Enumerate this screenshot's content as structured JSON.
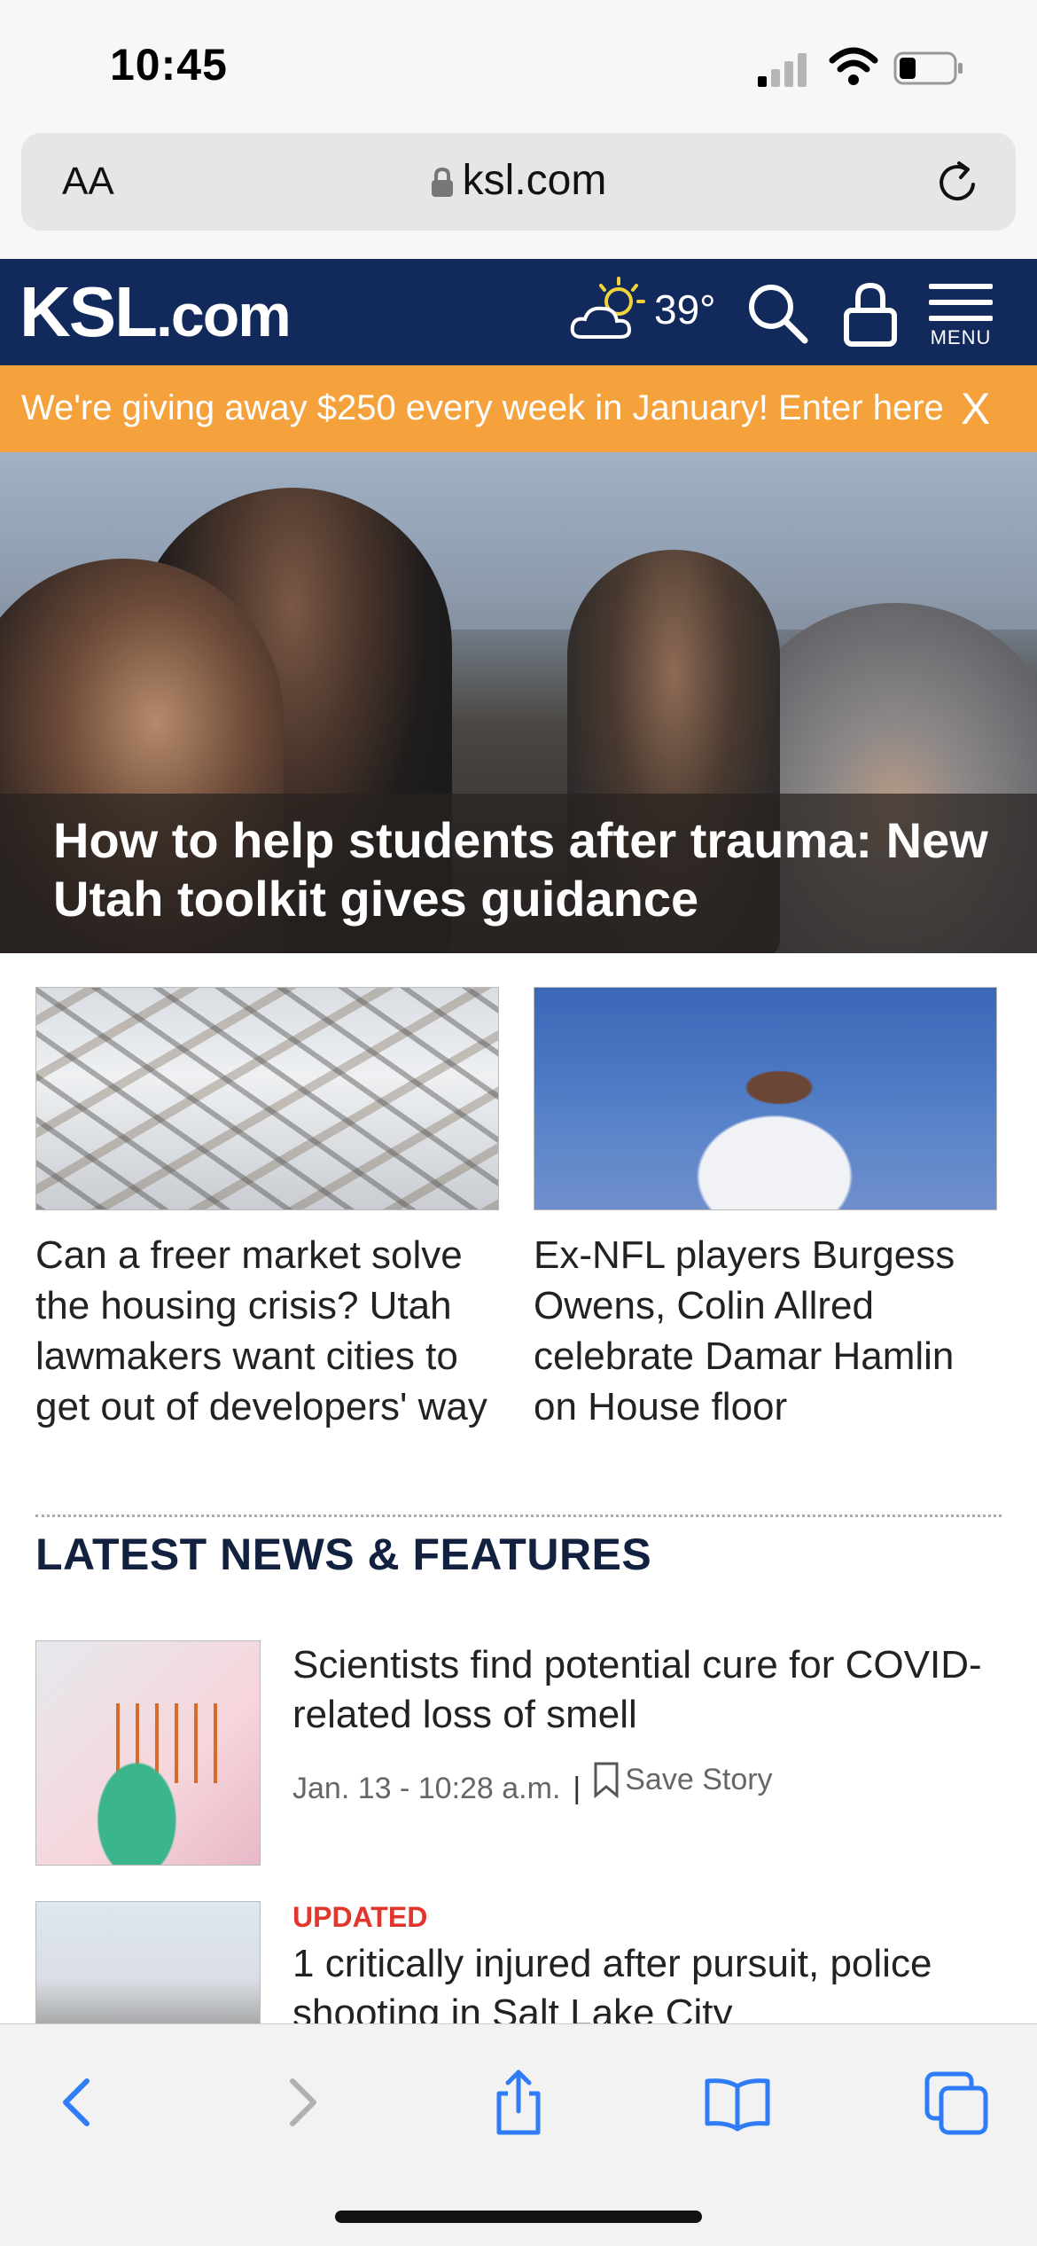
{
  "status_bar": {
    "time": "10:45"
  },
  "browser": {
    "text_size_label": "AA",
    "url": "ksl.com"
  },
  "header": {
    "logo": "KSL",
    "logo_suffix": ".com",
    "temperature": "39°",
    "menu_label": "MENU"
  },
  "promo": {
    "text": "We're giving away $250 every week in January! Enter here",
    "close": "X"
  },
  "hero": {
    "title": "How to help students after trauma: New Utah toolkit gives guidance"
  },
  "top_stories": [
    {
      "title": "Can a freer market solve the housing crisis? Utah lawmakers want cities to get out of developers' way"
    },
    {
      "title": "Ex-NFL players Burgess Owens, Colin Allred celebrate Damar Hamlin on House floor"
    }
  ],
  "latest": {
    "heading": "LATEST NEWS & FEATURES",
    "items": [
      {
        "title": "Scientists find potential cure for COVID-related loss of smell",
        "date": "Jan. 13 - 10:28 a.m.",
        "separator": "|",
        "save": "Save Story"
      },
      {
        "tag": "UPDATED",
        "title": "1 critically injured after pursuit, police shooting in Salt Lake City"
      }
    ]
  },
  "colors": {
    "brand_navy": "#12295c",
    "promo_orange": "#f5a13c",
    "updated_red": "#e0362b",
    "safari_blue": "#2f7cf6"
  }
}
